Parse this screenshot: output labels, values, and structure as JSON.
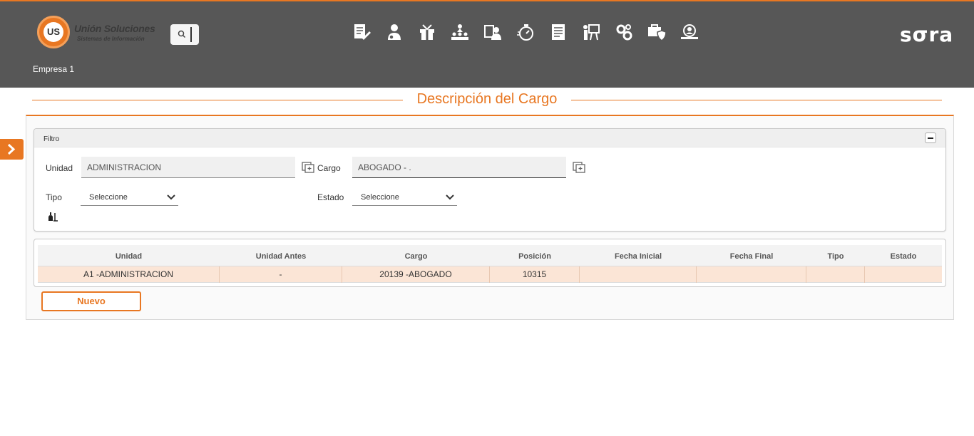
{
  "header": {
    "logo_mark": "US",
    "logo_title": "Unión Soluciones",
    "logo_subtitle": "Sistemas de Información",
    "brand": "sσra",
    "company": "Empresa 1",
    "accent_color": "#e87722",
    "bar_color": "#575757",
    "nav_icons": [
      "document-edit-icon",
      "user-settings-icon",
      "gift-icon",
      "org-chart-icon",
      "id-card-user-icon",
      "stopwatch-icon",
      "report-icon",
      "presentation-icon",
      "gears-icon",
      "briefcase-shield-icon",
      "user-search-icon"
    ]
  },
  "page": {
    "title": "Descripción del Cargo"
  },
  "filter": {
    "title": "Filtro",
    "unidad_label": "Unidad",
    "unidad_value": "ADMINISTRACION",
    "cargo_label": "Cargo",
    "cargo_value": "ABOGADO - .",
    "tipo_label": "Tipo",
    "tipo_value": "Seleccione",
    "estado_label": "Estado",
    "estado_value": "Seleccione"
  },
  "table": {
    "headers": [
      "Unidad",
      "Unidad Antes",
      "Cargo",
      "Posición",
      "Fecha Inicial",
      "Fecha Final",
      "Tipo",
      "Estado"
    ],
    "rows": [
      [
        "A1 -ADMINISTRACION",
        "-",
        "20139 -ABOGADO",
        "10315",
        "",
        "",
        "",
        ""
      ]
    ]
  },
  "actions": {
    "nuevo_label": "Nuevo"
  }
}
